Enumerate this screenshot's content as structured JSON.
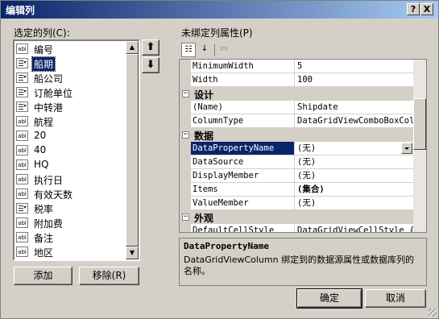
{
  "window": {
    "title": "编辑列"
  },
  "left": {
    "label": "选定的列(C):",
    "columns": [
      {
        "label": "编号",
        "icon": "textbox-column-icon"
      },
      {
        "label": "船期",
        "icon": "combobox-column-icon",
        "selected": true
      },
      {
        "label": "船公司",
        "icon": "combobox-column-icon"
      },
      {
        "label": "订舱单位",
        "icon": "combobox-column-icon"
      },
      {
        "label": "中转港",
        "icon": "combobox-column-icon"
      },
      {
        "label": "航程",
        "icon": "textbox-column-icon"
      },
      {
        "label": "20",
        "icon": "textbox-column-icon"
      },
      {
        "label": "40",
        "icon": "textbox-column-icon"
      },
      {
        "label": "HQ",
        "icon": "textbox-column-icon"
      },
      {
        "label": "执行日",
        "icon": "textbox-column-icon"
      },
      {
        "label": "有效天数",
        "icon": "textbox-column-icon"
      },
      {
        "label": "税率",
        "icon": "combobox-column-icon"
      },
      {
        "label": "附加费",
        "icon": "textbox-column-icon"
      },
      {
        "label": "备注",
        "icon": "textbox-column-icon"
      },
      {
        "label": "地区",
        "icon": "textbox-column-icon"
      }
    ],
    "abl_text": "abl",
    "add_label": "添加",
    "remove_label": "移除(R)"
  },
  "right": {
    "label": "未绑定列属性(P)",
    "rows": [
      {
        "kind": "prop",
        "name": "MinimumWidth",
        "value": "5"
      },
      {
        "kind": "prop",
        "name": "Width",
        "value": "100"
      },
      {
        "kind": "cat",
        "name": "设计"
      },
      {
        "kind": "prop",
        "name": "(Name)",
        "value": "Shipdate"
      },
      {
        "kind": "prop",
        "name": "ColumnType",
        "value": "DataGridViewComboBoxColu"
      },
      {
        "kind": "cat",
        "name": "数据"
      },
      {
        "kind": "prop",
        "name": "DataPropertyName",
        "value": "(无)",
        "selected": true,
        "dropdown": true
      },
      {
        "kind": "prop",
        "name": "DataSource",
        "value": "(无)"
      },
      {
        "kind": "prop",
        "name": "DisplayMember",
        "value": "(无)"
      },
      {
        "kind": "prop",
        "name": "Items",
        "value": "(集合)",
        "bold": true
      },
      {
        "kind": "prop",
        "name": "ValueMember",
        "value": "(无)"
      },
      {
        "kind": "cat",
        "name": "外观"
      },
      {
        "kind": "prop",
        "name": "DefaultCellStyle",
        "value": "DataGridViewCellStyle {"
      }
    ],
    "collapse_glyph": "−",
    "description": {
      "title": "DataPropertyName",
      "text": "DataGridViewColumn 绑定到的数据源属性或数据库列的名称。"
    }
  },
  "buttons": {
    "ok": "确定",
    "cancel": "取消"
  },
  "titlebar": {
    "help": "?",
    "close": "X"
  },
  "arrows": {
    "up": "⬆",
    "down": "⬇"
  }
}
